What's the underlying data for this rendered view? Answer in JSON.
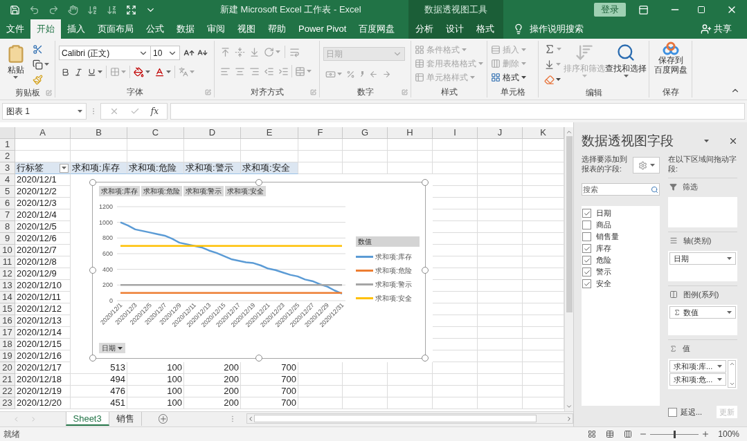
{
  "window": {
    "title": "新建 Microsoft Excel 工作表  -  Excel",
    "tool_group": "数据透视图工具",
    "sign_in": "登录"
  },
  "tabs": [
    {
      "label": "文件",
      "selected": false,
      "kind": "normal"
    },
    {
      "label": "开始",
      "selected": true,
      "kind": "normal"
    },
    {
      "label": "插入",
      "selected": false,
      "kind": "normal"
    },
    {
      "label": "页面布局",
      "selected": false,
      "kind": "normal"
    },
    {
      "label": "公式",
      "selected": false,
      "kind": "normal"
    },
    {
      "label": "数据",
      "selected": false,
      "kind": "normal"
    },
    {
      "label": "审阅",
      "selected": false,
      "kind": "normal"
    },
    {
      "label": "视图",
      "selected": false,
      "kind": "normal"
    },
    {
      "label": "帮助",
      "selected": false,
      "kind": "normal"
    },
    {
      "label": "Power Pivot",
      "selected": false,
      "kind": "normal"
    },
    {
      "label": "百度网盘",
      "selected": false,
      "kind": "normal"
    },
    {
      "label": "分析",
      "selected": false,
      "kind": "contextual"
    },
    {
      "label": "设计",
      "selected": false,
      "kind": "contextual"
    },
    {
      "label": "格式",
      "selected": false,
      "kind": "contextual"
    }
  ],
  "tell_me": "操作说明搜索",
  "share": "共享",
  "ribbon": {
    "clipboard": {
      "label": "剪贴板",
      "paste": "粘贴"
    },
    "font": {
      "label": "字体",
      "family": "Calibri (正文)",
      "size": "10"
    },
    "alignment": {
      "label": "对齐方式"
    },
    "number": {
      "label": "数字",
      "format": "日期"
    },
    "styles": {
      "label": "样式",
      "items": [
        {
          "label": "条件格式",
          "disabled": true
        },
        {
          "label": "套用表格格式",
          "disabled": true
        },
        {
          "label": "单元格样式",
          "disabled": true
        }
      ]
    },
    "cells": {
      "label": "单元格",
      "items": [
        {
          "label": "插入",
          "disabled": true
        },
        {
          "label": "删除",
          "disabled": true
        },
        {
          "label": "格式",
          "disabled": false
        }
      ]
    },
    "editing": {
      "label": "编辑",
      "buttons": [
        {
          "label": "排序和筛选",
          "disabled": true
        },
        {
          "label": "查找和选择",
          "disabled": false
        }
      ]
    },
    "save": {
      "label": "保存",
      "button": [
        "保存到",
        "百度网盘"
      ]
    }
  },
  "name_box": "图表 1",
  "function_label": "fx",
  "columns": [
    "A",
    "B",
    "C",
    "D",
    "E",
    "F",
    "G",
    "H",
    "I",
    "J",
    "K"
  ],
  "rows": [
    {
      "number": "1",
      "kind": "plain",
      "cells": []
    },
    {
      "number": "2",
      "kind": "plain",
      "cells": []
    },
    {
      "number": "3",
      "kind": "pivot_header",
      "cells": [
        "行标签",
        "求和项:库存",
        "求和项:危险",
        "求和项:警示",
        "求和项:安全"
      ]
    },
    {
      "number": "4",
      "kind": "plain",
      "cells": [
        "2020/12/1"
      ]
    },
    {
      "number": "5",
      "kind": "plain",
      "cells": [
        "2020/12/2"
      ]
    },
    {
      "number": "6",
      "kind": "plain",
      "cells": [
        "2020/12/3"
      ]
    },
    {
      "number": "7",
      "kind": "plain",
      "cells": [
        "2020/12/4"
      ]
    },
    {
      "number": "8",
      "kind": "plain",
      "cells": [
        "2020/12/5"
      ]
    },
    {
      "number": "9",
      "kind": "plain",
      "cells": [
        "2020/12/6"
      ]
    },
    {
      "number": "10",
      "kind": "plain",
      "cells": [
        "2020/12/7"
      ]
    },
    {
      "number": "11",
      "kind": "plain",
      "cells": [
        "2020/12/8"
      ]
    },
    {
      "number": "12",
      "kind": "plain",
      "cells": [
        "2020/12/9"
      ]
    },
    {
      "number": "13",
      "kind": "plain",
      "cells": [
        "2020/12/10"
      ]
    },
    {
      "number": "14",
      "kind": "plain",
      "cells": [
        "2020/12/11"
      ]
    },
    {
      "number": "15",
      "kind": "plain",
      "cells": [
        "2020/12/12"
      ]
    },
    {
      "number": "16",
      "kind": "plain",
      "cells": [
        "2020/12/13"
      ]
    },
    {
      "number": "17",
      "kind": "plain",
      "cells": [
        "2020/12/14"
      ]
    },
    {
      "number": "18",
      "kind": "plain",
      "cells": [
        "2020/12/15"
      ]
    },
    {
      "number": "19",
      "kind": "plain",
      "cells": [
        "2020/12/16"
      ]
    },
    {
      "number": "20",
      "kind": "plain",
      "cells": [
        "2020/12/17",
        "513",
        "100",
        "200",
        "700"
      ]
    },
    {
      "number": "21",
      "kind": "plain",
      "cells": [
        "2020/12/18",
        "494",
        "100",
        "200",
        "700"
      ]
    },
    {
      "number": "22",
      "kind": "plain",
      "cells": [
        "2020/12/19",
        "476",
        "100",
        "200",
        "700"
      ]
    },
    {
      "number": "23",
      "kind": "plain",
      "cells": [
        "2020/12/20",
        "451",
        "100",
        "200",
        "700"
      ]
    }
  ],
  "chart": {
    "filter_buttons": [
      "求和项:库存",
      "求和项:危险",
      "求和项:警示",
      "求和项:安全"
    ],
    "legend_title": "数值",
    "axis_button": "日期",
    "chart_data": {
      "type": "line",
      "categories": [
        "2020/12/1",
        null,
        "2020/12/3",
        null,
        "2020/12/5",
        null,
        "2020/12/7",
        null,
        "2020/12/9",
        null,
        "2020/12/11",
        null,
        "2020/12/13",
        null,
        "2020/12/15",
        null,
        "2020/12/17",
        null,
        "2020/12/19",
        null,
        "2020/12/21",
        null,
        "2020/12/23",
        null,
        "2020/12/25",
        null,
        "2020/12/27",
        null,
        "2020/12/29",
        null,
        "2020/12/31"
      ],
      "ylim": [
        0,
        1200
      ],
      "grid": true,
      "yticks": [
        0,
        200,
        400,
        600,
        800,
        1000,
        1200
      ],
      "series": [
        {
          "name": "求和项:库存",
          "color": "#5b9bd5",
          "values": [
            1000,
            960,
            910,
            890,
            870,
            850,
            830,
            790,
            740,
            720,
            700,
            680,
            640,
            610,
            570,
            530,
            510,
            490,
            480,
            450,
            410,
            390,
            360,
            330,
            310,
            270,
            250,
            210,
            180,
            130,
            90
          ]
        },
        {
          "name": "求和项:危险",
          "color": "#ed7d31",
          "values": [
            100,
            100,
            100,
            100,
            100,
            100,
            100,
            100,
            100,
            100,
            100,
            100,
            100,
            100,
            100,
            100,
            100,
            100,
            100,
            100,
            100,
            100,
            100,
            100,
            100,
            100,
            100,
            100,
            100,
            100,
            100
          ]
        },
        {
          "name": "求和项:警示",
          "color": "#a5a5a5",
          "values": [
            200,
            200,
            200,
            200,
            200,
            200,
            200,
            200,
            200,
            200,
            200,
            200,
            200,
            200,
            200,
            200,
            200,
            200,
            200,
            200,
            200,
            200,
            200,
            200,
            200,
            200,
            200,
            200,
            200,
            200,
            200
          ]
        },
        {
          "name": "求和项:安全",
          "color": "#ffc000",
          "values": [
            700,
            700,
            700,
            700,
            700,
            700,
            700,
            700,
            700,
            700,
            700,
            700,
            700,
            700,
            700,
            700,
            700,
            700,
            700,
            700,
            700,
            700,
            700,
            700,
            700,
            700,
            700,
            700,
            700,
            700,
            700
          ]
        }
      ]
    }
  },
  "sheet_tabs": [
    {
      "label": "Sheet3",
      "selected": true
    },
    {
      "label": "销售",
      "selected": false
    }
  ],
  "field_pane": {
    "title": "数据透视图字段",
    "choose_hint": "选择要添加到报表的字段:",
    "search_placeholder": "搜索",
    "fields": [
      {
        "label": "日期",
        "checked": true
      },
      {
        "label": "商品",
        "checked": false
      },
      {
        "label": "销售量",
        "checked": false
      },
      {
        "label": "库存",
        "checked": true
      },
      {
        "label": "危险",
        "checked": true
      },
      {
        "label": "警示",
        "checked": true
      },
      {
        "label": "安全",
        "checked": true
      }
    ],
    "drag_hint": "在以下区域间拖动字段:",
    "areas": [
      {
        "kind": "filter",
        "label": "筛选"
      },
      {
        "kind": "axis",
        "label": "轴(类别)",
        "items": [
          {
            "label": "日期",
            "kind": "field"
          }
        ]
      },
      {
        "kind": "legend",
        "label": "图例(系列)",
        "items": [
          {
            "label": "数值",
            "kind": "sigma"
          }
        ]
      },
      {
        "kind": "values",
        "label": "值",
        "items": [
          {
            "label": "求和项:库...",
            "kind": "field"
          },
          {
            "label": "求和项:危...",
            "kind": "field"
          }
        ]
      }
    ],
    "defer": {
      "label": "延迟...",
      "checked": false
    },
    "update": {
      "label": "更新",
      "disabled": true
    }
  },
  "status_bar": {
    "text": "就绪",
    "zoom": "100%",
    "level": 0.5
  }
}
